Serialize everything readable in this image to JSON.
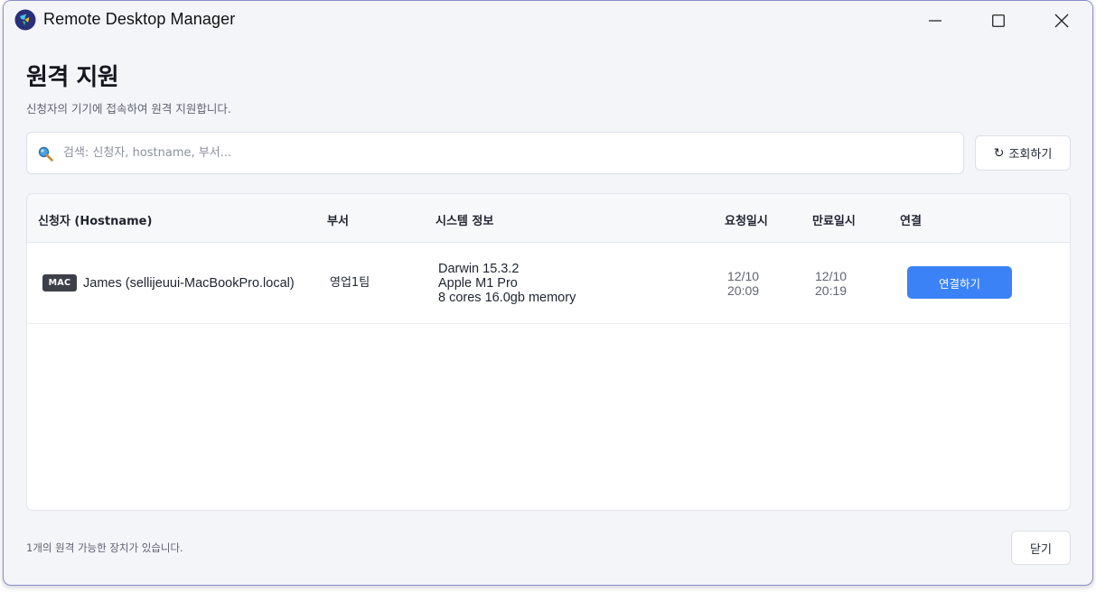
{
  "window": {
    "title": "Remote Desktop Manager",
    "controls": [
      "minimize",
      "maximize",
      "close"
    ]
  },
  "header": {
    "title": "원격 지원",
    "subtitle": "신청자의 기기에 접속하여 원격 지원합니다."
  },
  "search": {
    "placeholder": "검색: 신청자, hostname, 부서...",
    "value": "",
    "icon": "search-icon"
  },
  "refresh_button": {
    "label": "조회하기",
    "icon": "refresh-icon"
  },
  "table": {
    "columns": [
      "신청자 (Hostname)",
      "부서",
      "시스템 정보",
      "요청일시",
      "만료일시",
      "연결"
    ],
    "rows": [
      {
        "os_badge": "MAC",
        "requester": "James (sellijeuui-MacBookPro.local)",
        "department": "영업1팀",
        "system_info": [
          "Darwin 15.3.2",
          "Apple M1 Pro",
          "8 cores 16.0gb memory"
        ],
        "requested_at": [
          "12/10",
          "20:09"
        ],
        "expires_at": [
          "12/10",
          "20:19"
        ],
        "connect_label": "연결하기"
      }
    ]
  },
  "footer": {
    "status": "1개의 원격 가능한 장치가 있습니다.",
    "close_label": "닫기"
  },
  "colors": {
    "accent": "#3b82f6",
    "badge_bg": "#3d4048",
    "window_bg": "#f4f5f9",
    "window_border": "#8a8ec4"
  }
}
